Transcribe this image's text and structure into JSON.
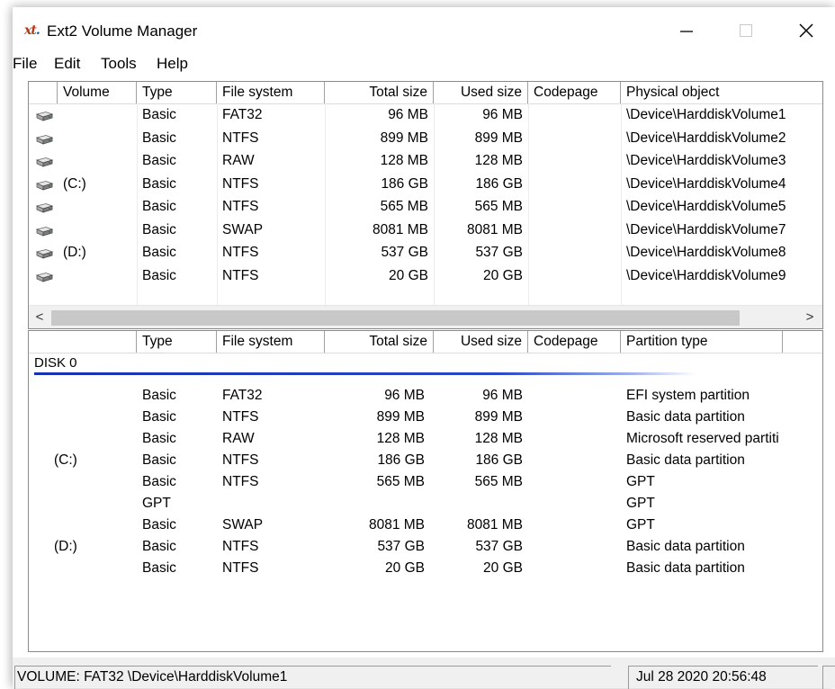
{
  "window": {
    "title": "Ext2 Volume Manager",
    "icon_text_a": "xt",
    "icon_text_b": "."
  },
  "menu": [
    "File",
    "Edit",
    "Tools",
    "Help"
  ],
  "volumes": {
    "columns": [
      "",
      "Volume",
      "Type",
      "File system",
      "Total size",
      "Used size",
      "Codepage",
      "Physical object"
    ],
    "rows": [
      {
        "volume": "",
        "type": "Basic",
        "fs": "FAT32",
        "total": "96 MB",
        "used": "96 MB",
        "codepage": "",
        "physical": "\\Device\\HarddiskVolume1"
      },
      {
        "volume": "",
        "type": "Basic",
        "fs": "NTFS",
        "total": "899 MB",
        "used": "899 MB",
        "codepage": "",
        "physical": "\\Device\\HarddiskVolume2"
      },
      {
        "volume": "",
        "type": "Basic",
        "fs": "RAW",
        "total": "128 MB",
        "used": "128 MB",
        "codepage": "",
        "physical": "\\Device\\HarddiskVolume3"
      },
      {
        "volume": "(C:)",
        "type": "Basic",
        "fs": "NTFS",
        "total": "186 GB",
        "used": "186 GB",
        "codepage": "",
        "physical": "\\Device\\HarddiskVolume4"
      },
      {
        "volume": "",
        "type": "Basic",
        "fs": "NTFS",
        "total": "565 MB",
        "used": "565 MB",
        "codepage": "",
        "physical": "\\Device\\HarddiskVolume5"
      },
      {
        "volume": "",
        "type": "Basic",
        "fs": "SWAP",
        "total": "8081 MB",
        "used": "8081 MB",
        "codepage": "",
        "physical": "\\Device\\HarddiskVolume7"
      },
      {
        "volume": "(D:)",
        "type": "Basic",
        "fs": "NTFS",
        "total": "537 GB",
        "used": "537 GB",
        "codepage": "",
        "physical": "\\Device\\HarddiskVolume8"
      },
      {
        "volume": "",
        "type": "Basic",
        "fs": "NTFS",
        "total": "20 GB",
        "used": "20 GB",
        "codepage": "",
        "physical": "\\Device\\HarddiskVolume9"
      }
    ]
  },
  "partitions": {
    "columns": [
      "",
      "Type",
      "File system",
      "Total size",
      "Used size",
      "Codepage",
      "Partition type"
    ],
    "disk_label": "DISK 0",
    "rows": [
      {
        "volume": "",
        "type": "Basic",
        "fs": "FAT32",
        "total": "96 MB",
        "used": "96 MB",
        "ptype": "EFI system partition"
      },
      {
        "volume": "",
        "type": "Basic",
        "fs": "NTFS",
        "total": "899 MB",
        "used": "899 MB",
        "ptype": "Basic data partition"
      },
      {
        "volume": "",
        "type": "Basic",
        "fs": "RAW",
        "total": "128 MB",
        "used": "128 MB",
        "ptype": "Microsoft reserved partiti"
      },
      {
        "volume": "(C:)",
        "type": "Basic",
        "fs": "NTFS",
        "total": "186 GB",
        "used": "186 GB",
        "ptype": "Basic data partition"
      },
      {
        "volume": "",
        "type": "Basic",
        "fs": "NTFS",
        "total": "565 MB",
        "used": "565 MB",
        "ptype": "GPT"
      },
      {
        "volume": "",
        "type": "GPT",
        "fs": "",
        "total": "",
        "used": "",
        "ptype": "GPT"
      },
      {
        "volume": "",
        "type": "Basic",
        "fs": "SWAP",
        "total": "8081 MB",
        "used": "8081 MB",
        "ptype": "GPT"
      },
      {
        "volume": "(D:)",
        "type": "Basic",
        "fs": "NTFS",
        "total": "537 GB",
        "used": "537 GB",
        "ptype": "Basic data partition"
      },
      {
        "volume": "",
        "type": "Basic",
        "fs": "NTFS",
        "total": "20 GB",
        "used": "20 GB",
        "ptype": "Basic data partition"
      }
    ]
  },
  "scroll": {
    "left": "<",
    "right": ">"
  },
  "status": {
    "left": "VOLUME:  FAT32 \\Device\\HarddiskVolume1",
    "right": "Jul 28 2020 20:56:48"
  },
  "icons": {
    "disk": "drive-icon",
    "minimize": "minimize-icon",
    "maximize": "maximize-icon",
    "close": "close-icon"
  }
}
